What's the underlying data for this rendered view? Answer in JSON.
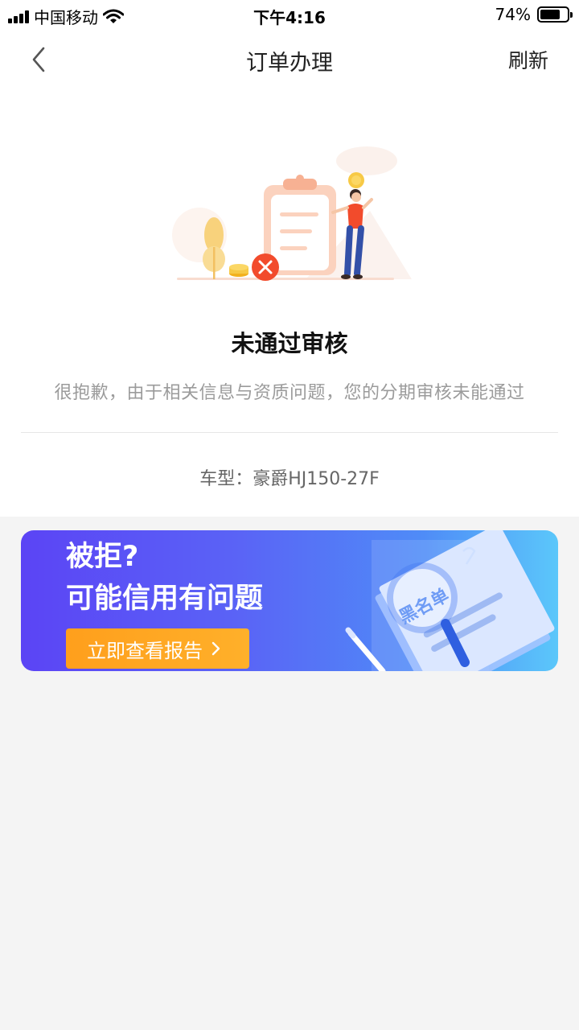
{
  "status_bar": {
    "carrier": "中国移动",
    "time": "下午4:16",
    "battery_percent": "74%",
    "battery_level": 0.74
  },
  "nav": {
    "title": "订单办理",
    "refresh_label": "刷新"
  },
  "result": {
    "title": "未通过审核",
    "description": "很抱歉，由于相关信息与资质问题，您的分期审核未能通过",
    "model_line": "车型：豪爵HJ150-27F"
  },
  "banner": {
    "line1": "被拒?",
    "line2": "可能信用有问题",
    "button_label": "立即查看报告",
    "stamp_text": "黑名单"
  },
  "colors": {
    "accent_orange": "#ff9f1c",
    "error_red": "#f24b2c",
    "banner_start": "#5b44f5",
    "banner_end": "#5bc7fa"
  }
}
